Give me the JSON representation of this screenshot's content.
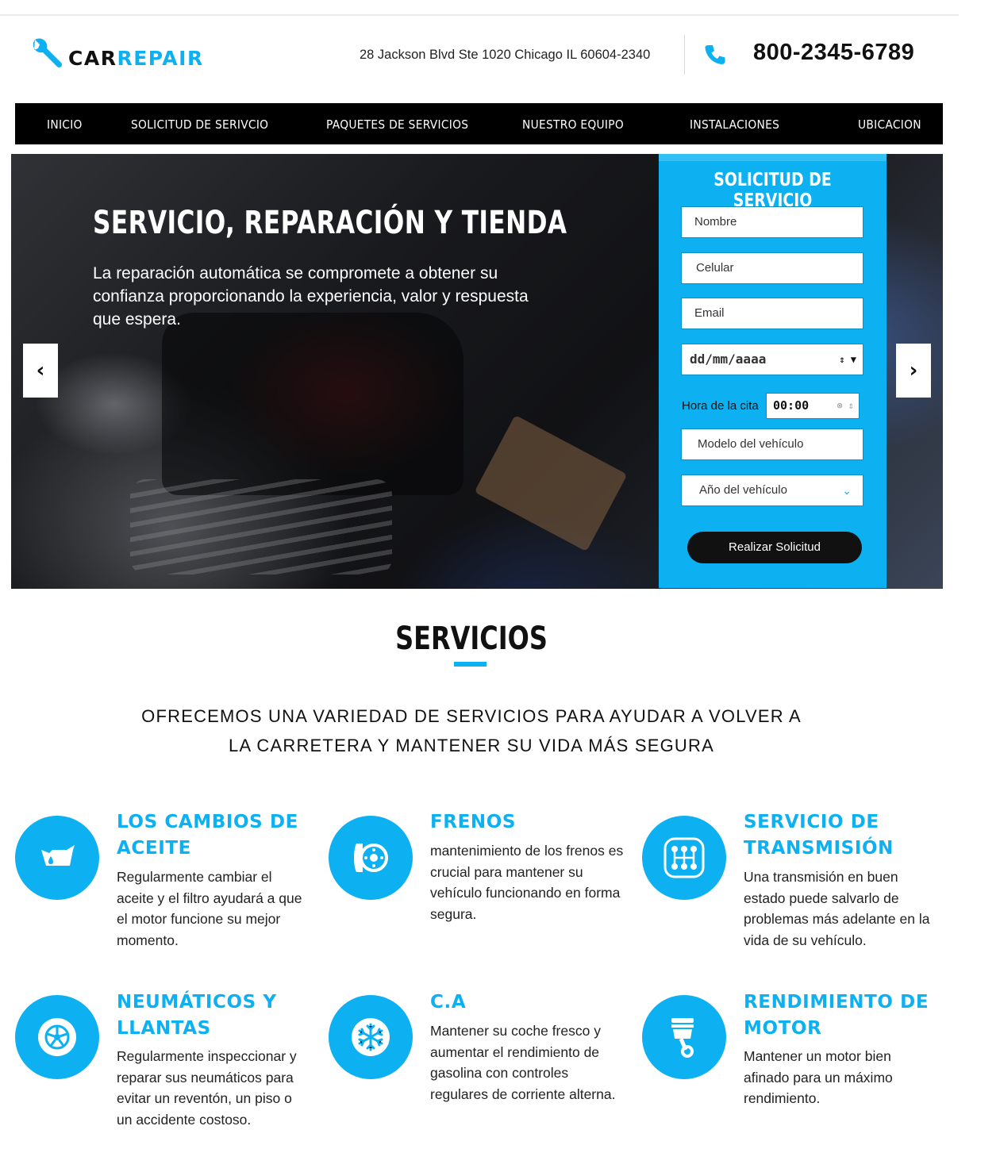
{
  "brand": {
    "part1": "CAR",
    "part2": "REPAIR"
  },
  "header": {
    "address": "28 Jackson Blvd Ste 1020 Chicago IL 60604-2340",
    "phone": "800-2345-6789"
  },
  "nav": {
    "items": [
      {
        "label": "INICIO"
      },
      {
        "label": "SOLICITUD DE SERIVCIO"
      },
      {
        "label": "PAQUETES DE SERVICIOS"
      },
      {
        "label": "NUESTRO EQUIPO"
      },
      {
        "label": "INSTALACIONES"
      },
      {
        "label": "UBICACION"
      }
    ]
  },
  "hero": {
    "title": "SERVICIO, REPARACIÓN Y TIENDA",
    "text": "La reparación automática se compromete a obtener su confianza proporcionando la experiencia, valor y respuesta que espera.",
    "prev": "‹",
    "next": "›"
  },
  "form": {
    "title": "SOLICITUD DE SERVICIO",
    "name_placeholder": "Nombre",
    "cell_placeholder": "Celular",
    "email_placeholder": "Email",
    "date_value": "dd/mm/aaaa",
    "time_label": "Hora de la cita",
    "time_value": "00:00",
    "model_placeholder": "Modelo del vehículo",
    "year_value": "Año del vehículo",
    "submit": "Realizar Solicitud"
  },
  "services": {
    "title": "SERVICIOS",
    "subtitle_line1": "OFRECEMOS UNA VARIEDAD DE SERVICIOS PARA AYUDAR A VOLVER A",
    "subtitle_line2": "LA CARRETERA Y MANTENER SU VIDA MÁS SEGURA",
    "items": [
      {
        "title": "LOS CAMBIOS DE ACEITE",
        "desc": "Regularmente cambiar el aceite y el filtro ayudará a que el motor funcione su mejor momento.",
        "icon": "oil-can-icon"
      },
      {
        "title": "FRENOS",
        "desc": "mantenimiento de los frenos es crucial para mantener su vehículo funcionando en forma segura.",
        "icon": "brake-disc-icon"
      },
      {
        "title": "SERVICIO DE TRANSMISIÓN",
        "desc": "Una transmisión en buen estado puede salvarlo de problemas más adelante en la vida de su vehículo.",
        "icon": "gearshift-icon"
      },
      {
        "title": "NEUMÁTICOS Y LLANTAS",
        "desc": "Regularmente inspeccionar y reparar sus neumáticos para evitar un reventón, un piso o un accidente costoso.",
        "icon": "wheel-icon"
      },
      {
        "title": "C.A",
        "desc": "Mantener su coche fresco y aumentar el rendimiento de gasolina con controles regulares de corriente alterna.",
        "icon": "snowflake-icon"
      },
      {
        "title": "RENDIMIENTO DE MOTOR",
        "desc": "Mantener un motor bien afinado para un máximo rendimiento.",
        "icon": "piston-icon"
      }
    ]
  },
  "colors": {
    "accent": "#0db0f0",
    "nav_bg": "#000000",
    "button_bg": "#111111"
  }
}
